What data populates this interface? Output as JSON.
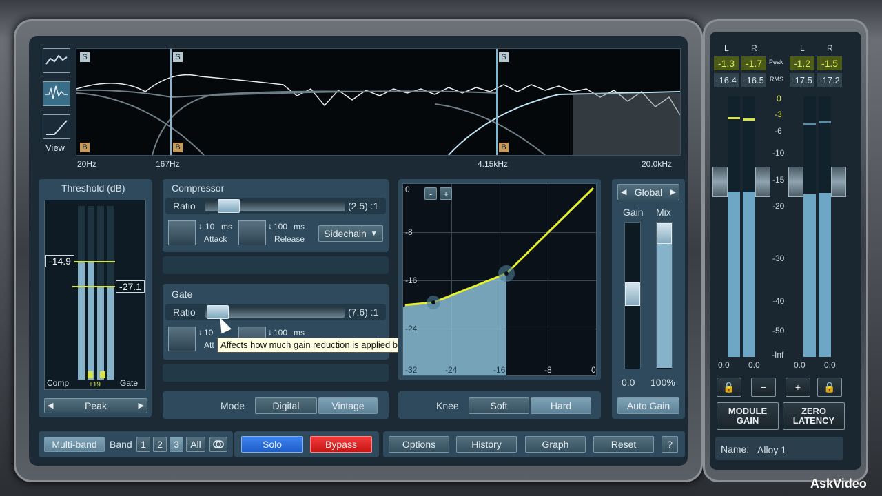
{
  "view": {
    "label": "View",
    "freq_labels": [
      "20Hz",
      "167Hz",
      "4.15kHz",
      "20.0kHz"
    ],
    "band_solo_labels": [
      "S",
      "S",
      "S"
    ],
    "band_bypass_labels": [
      "B",
      "B",
      "B"
    ],
    "icons": [
      "waveform-view-icon",
      "spectrum-view-icon",
      "curve-view-icon"
    ]
  },
  "threshold": {
    "title": "Threshold (dB)",
    "comp_value": "-14.9",
    "gate_value": "-27.1",
    "comp_label": "Comp",
    "gate_label": "Gate",
    "gr_value": "+19",
    "mode_value": "Peak"
  },
  "compressor": {
    "title": "Compressor",
    "ratio_label": "Ratio",
    "ratio_value": "(2.5) :1",
    "attack_value": "10",
    "attack_unit": "ms",
    "attack_label": "Attack",
    "release_value": "100",
    "release_unit": "ms",
    "release_label": "Release",
    "sidechain_label": "Sidechain"
  },
  "gate": {
    "title": "Gate",
    "ratio_label": "Ratio",
    "ratio_value": "(7.6) :1",
    "attack_value": "10",
    "attack_label": "Att",
    "release_value": "100",
    "release_unit": "ms"
  },
  "tooltip": "Affects how much gain reduction is applied below the threshold",
  "mode": {
    "label": "Mode",
    "options": [
      "Digital",
      "Vintage"
    ]
  },
  "graph": {
    "plus": "+",
    "minus": "-",
    "y_labels": [
      "0",
      "-8",
      "-16",
      "-24",
      "-32"
    ],
    "x_labels": [
      "-32",
      "-24",
      "-16",
      "-8",
      "0"
    ],
    "curve_color": "#e6f02a"
  },
  "knee": {
    "label": "Knee",
    "options": [
      "Soft",
      "Hard"
    ]
  },
  "global": {
    "title": "Global",
    "gain_label": "Gain",
    "mix_label": "Mix",
    "gain_value": "0.0",
    "mix_value": "100%",
    "auto_gain_label": "Auto Gain"
  },
  "bottom_bar": {
    "multiband": "Multi-band",
    "band_label": "Band",
    "bands": [
      "1",
      "2",
      "3",
      "All"
    ],
    "solo": "Solo",
    "bypass": "Bypass",
    "options": "Options",
    "history": "History",
    "graph": "Graph",
    "reset": "Reset",
    "help": "?"
  },
  "meters": {
    "l": "L",
    "r": "R",
    "peak_label": "Peak",
    "rms_label": "RMS",
    "in_peak_l": "-1.3",
    "in_peak_r": "-1.7",
    "out_peak_l": "-1.2",
    "out_peak_r": "-1.5",
    "in_rms_l": "-16.4",
    "in_rms_r": "-16.5",
    "out_rms_l": "-17.5",
    "out_rms_r": "-17.2",
    "scale": [
      "0",
      "-3",
      "-6",
      "-10",
      "-15",
      "-20",
      "-30",
      "-40",
      "-50",
      "-Inf"
    ],
    "fader_values": [
      "0.0",
      "0.0",
      "0.0",
      "0.0"
    ],
    "module_gain": "MODULE GAIN",
    "zero_latency": "ZERO LATENCY",
    "name_label": "Name:",
    "name_value": "Alloy 1"
  },
  "watermark": "AskVideo",
  "colors": {
    "accent": "#7fb8d6",
    "solo": "#2a6de0",
    "bypass": "#e02222",
    "value_green": "#cfe24a"
  }
}
